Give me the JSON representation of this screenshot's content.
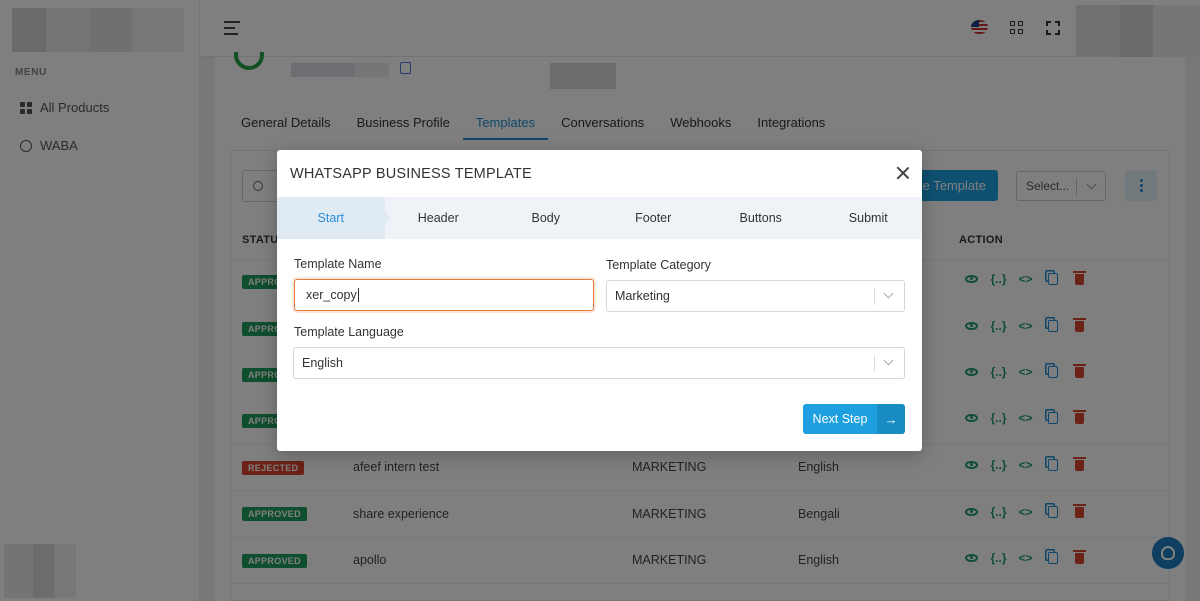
{
  "sidebar": {
    "menu_label": "MENU",
    "items": [
      {
        "label": "All Products",
        "icon": "grid-icon"
      },
      {
        "label": "WABA",
        "icon": "whatsapp-icon"
      }
    ]
  },
  "page": {
    "tabs": [
      "General Details",
      "Business Profile",
      "Templates",
      "Conversations",
      "Webhooks",
      "Integrations"
    ],
    "active_tab": "Templates",
    "create_button_label": "e Template",
    "filter_select_placeholder": "Select...",
    "table": {
      "headers": {
        "status": "STATUS",
        "action": "ACTION"
      },
      "rows": [
        {
          "status": "APPROVED"
        },
        {
          "status": "APPROVED"
        },
        {
          "status": "APPROVED"
        },
        {
          "status": "APPROVED"
        },
        {
          "status": "REJECTED",
          "name": "afeef intern test",
          "category": "MARKETING",
          "language": "English"
        },
        {
          "status": "APPROVED",
          "name": "share experience",
          "category": "MARKETING",
          "language": "Bengali"
        },
        {
          "status": "APPROVED",
          "name": "apollo",
          "category": "MARKETING",
          "language": "English"
        }
      ],
      "action_icons": [
        "eye-icon",
        "variables-icon",
        "code-icon",
        "copy-icon",
        "trash-icon"
      ]
    }
  },
  "modal": {
    "title": "WHATSAPP BUSINESS TEMPLATE",
    "steps": [
      "Start",
      "Header",
      "Body",
      "Footer",
      "Buttons",
      "Submit"
    ],
    "active_step": "Start",
    "fields": {
      "template_name": {
        "label": "Template Name",
        "value": "xer_copy"
      },
      "template_category": {
        "label": "Template Category",
        "value": "Marketing"
      },
      "template_language": {
        "label": "Template Language",
        "value": "English"
      }
    },
    "next_button_label": "Next Step",
    "next_button_icon": "→"
  },
  "colors": {
    "primary": "#1ea0e0",
    "approved": "#1f9d5c",
    "rejected": "#d8452f",
    "focus_border": "#e57a3f"
  }
}
